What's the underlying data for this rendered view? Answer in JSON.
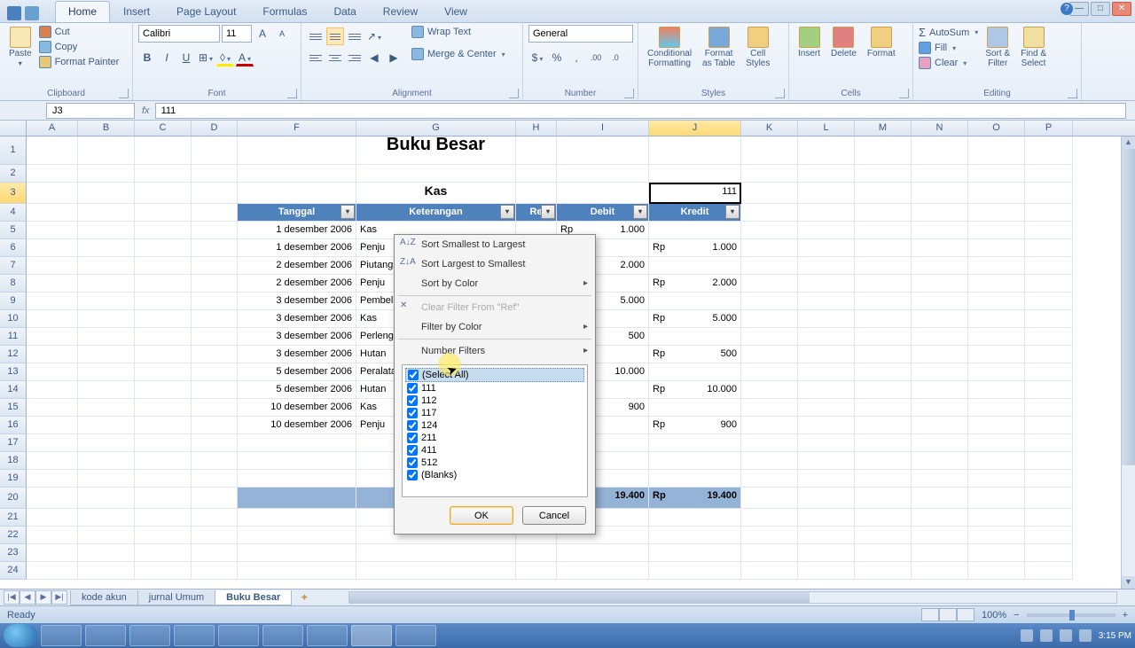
{
  "tabs": [
    "Home",
    "Insert",
    "Page Layout",
    "Formulas",
    "Data",
    "Review",
    "View"
  ],
  "active_tab": "Home",
  "clipboard": {
    "paste": "Paste",
    "cut": "Cut",
    "copy": "Copy",
    "fp": "Format Painter",
    "label": "Clipboard"
  },
  "font": {
    "name": "Calibri",
    "size": "11",
    "label": "Font"
  },
  "alignment": {
    "wrap": "Wrap Text",
    "merge": "Merge & Center",
    "label": "Alignment"
  },
  "number": {
    "format": "General",
    "label": "Number"
  },
  "styles": {
    "cf": "Conditional\nFormatting",
    "fat": "Format\nas Table",
    "cs": "Cell\nStyles",
    "label": "Styles"
  },
  "cells": {
    "ins": "Insert",
    "del": "Delete",
    "fmt": "Format",
    "label": "Cells"
  },
  "editing": {
    "sum": "AutoSum",
    "fill": "Fill",
    "clear": "Clear",
    "sort": "Sort &\nFilter",
    "find": "Find &\nSelect",
    "label": "Editing"
  },
  "name_box": "J3",
  "formula": "111",
  "cols": [
    "A",
    "B",
    "C",
    "D",
    "F",
    "G",
    "H",
    "I",
    "J",
    "K",
    "L",
    "M",
    "N",
    "O",
    "P"
  ],
  "col_classes": [
    "cA",
    "cB",
    "cC",
    "cD",
    "cF",
    "cG",
    "cH",
    "cI",
    "cJ",
    "cK",
    "cL",
    "cM",
    "cN",
    "cO",
    "cP"
  ],
  "sel_col": "J",
  "sel_row": 3,
  "title": "Buku Besar",
  "subtitle": "Kas",
  "j3": "111",
  "headers": [
    "Tanggal",
    "Keterangan",
    "Re",
    "Debit",
    "Kredit"
  ],
  "data_rows": [
    {
      "tgl": "1 desember 2006",
      "ket": "Kas",
      "deb": "1.000",
      "kre": ""
    },
    {
      "tgl": "1 desember 2006",
      "ket": "Penju",
      "deb": "",
      "kre": "1.000"
    },
    {
      "tgl": "2 desember 2006",
      "ket": "Piutang",
      "deb": "2.000",
      "kre": ""
    },
    {
      "tgl": "2 desember 2006",
      "ket": "Penju",
      "deb": "",
      "kre": "2.000"
    },
    {
      "tgl": "3 desember 2006",
      "ket": "Pembel",
      "deb": "5.000",
      "kre": ""
    },
    {
      "tgl": "3 desember 2006",
      "ket": "Kas",
      "deb": "",
      "kre": "5.000"
    },
    {
      "tgl": "3 desember 2006",
      "ket": "Perleng",
      "deb": "500",
      "kre": ""
    },
    {
      "tgl": "3 desember 2006",
      "ket": "Hutan",
      "deb": "",
      "kre": "500"
    },
    {
      "tgl": "5 desember 2006",
      "ket": "Peralata",
      "deb": "10.000",
      "kre": ""
    },
    {
      "tgl": "5 desember 2006",
      "ket": "Hutan",
      "deb": "",
      "kre": "10.000"
    },
    {
      "tgl": "10 desember 2006",
      "ket": "Kas",
      "deb": "900",
      "kre": ""
    },
    {
      "tgl": "10 desember 2006",
      "ket": "Penju",
      "deb": "",
      "kre": "900"
    }
  ],
  "totals": {
    "deb": "19.400",
    "kre": "19.400"
  },
  "filter": {
    "s1": "Sort Smallest to Largest",
    "s2": "Sort Largest to Smallest",
    "sc": "Sort by Color",
    "cf": "Clear Filter From \"Ref\"",
    "fc": "Filter by Color",
    "nf": "Number Filters",
    "items": [
      "(Select All)",
      "111",
      "112",
      "117",
      "124",
      "211",
      "411",
      "512",
      "(Blanks)"
    ],
    "ok": "OK",
    "cancel": "Cancel"
  },
  "sheets": [
    "kode akun",
    "jurnal Umum",
    "Buku Besar"
  ],
  "active_sheet": "Buku Besar",
  "status": "Ready",
  "zoom": "100%",
  "time": "3:15 PM",
  "rp": "Rp"
}
